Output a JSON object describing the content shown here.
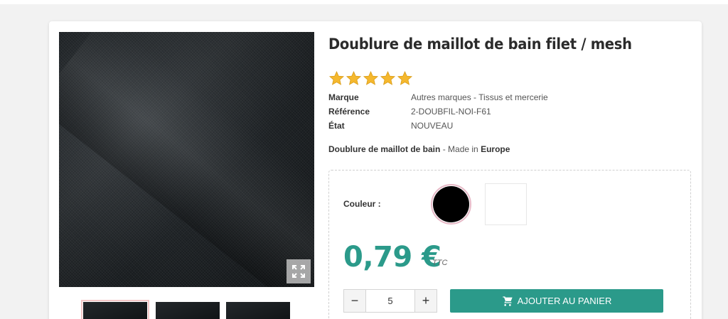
{
  "product": {
    "title": "Doublure de maillot de bain filet / mesh",
    "rating_stars": 5,
    "facts": [
      {
        "label": "Marque",
        "value": "Autres marques - Tissus et mercerie"
      },
      {
        "label": "Référence",
        "value": "2-DOUBFIL-NOI-F61"
      },
      {
        "label": "État",
        "value": "NOUVEAU"
      }
    ],
    "short_desc": {
      "bold1": "Doublure de maillot de bain",
      "mid": " - Made in ",
      "bold2": "Europe"
    }
  },
  "variants": {
    "color_label": "Couleur :",
    "swatches": [
      {
        "name": "Noir",
        "color": "#000000",
        "selected": true
      },
      {
        "name": "Blanc",
        "color": "#ffffff",
        "selected": false
      }
    ]
  },
  "price": {
    "amount": "0,79 €",
    "tax_label": "TTC",
    "accent_color": "#2b9a8a"
  },
  "purchase": {
    "minus": "−",
    "plus": "+",
    "quantity": "5",
    "add_to_cart_label": "AJOUTER AU PANIER",
    "cart_icon": "cart-icon"
  },
  "gallery": {
    "zoom_icon": "expand-icon",
    "thumbnail_count": 3
  }
}
